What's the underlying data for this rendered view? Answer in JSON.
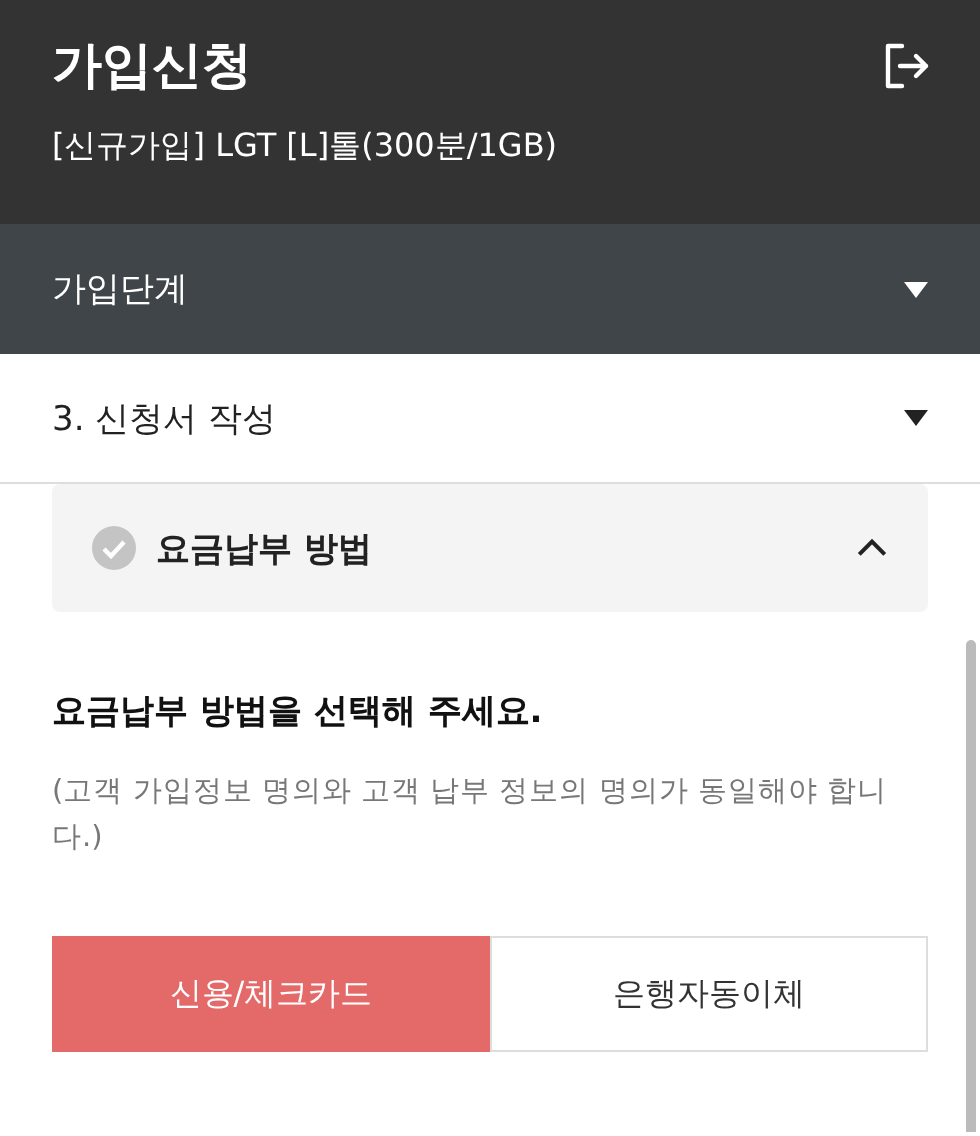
{
  "header": {
    "title": "가입신청",
    "subtitle": "[신규가입] LGT [L]톨(300분/1GB)"
  },
  "sections": [
    {
      "label": "가입단계",
      "kind": "dark"
    },
    {
      "label": "3. 신청서 작성",
      "kind": "light"
    }
  ],
  "panel": {
    "title": "요금납부 방법",
    "expanded": true,
    "prompt": "요금납부 방법을 선택해 주세요.",
    "note": "(고객 가입정보 명의와 고객 납부 정보의 명의가 동일해야 합니다.)",
    "options": [
      {
        "label": "신용/체크카드",
        "selected": true
      },
      {
        "label": "은행자동이체",
        "selected": false
      }
    ]
  }
}
